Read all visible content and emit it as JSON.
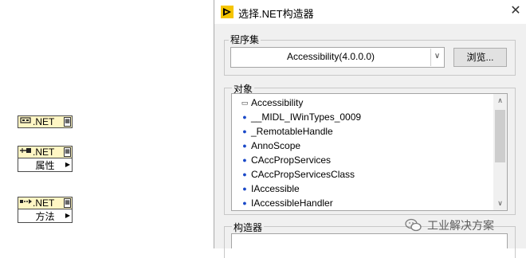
{
  "nodes": [
    {
      "icon_name": "constructor-node-icon",
      "label": ".NET",
      "rows": []
    },
    {
      "icon_name": "property-node-icon",
      "label": ".NET",
      "rows": [
        "属性"
      ]
    },
    {
      "icon_name": "invoke-node-icon",
      "label": ".NET",
      "rows": [
        "方法"
      ]
    }
  ],
  "dialog": {
    "title": "选择.NET构造器",
    "close_glyph": "✕",
    "assembly_label": "程序集",
    "assembly_value": "Accessibility(4.0.0.0)",
    "browse_label": "浏览...",
    "objects_label": "对象",
    "objects": [
      {
        "text": "Accessibility",
        "bullet": "▭"
      },
      {
        "text": "__MIDL_IWinTypes_0009",
        "bullet": "●"
      },
      {
        "text": "_RemotableHandle",
        "bullet": "●"
      },
      {
        "text": "AnnoScope",
        "bullet": "●"
      },
      {
        "text": "CAccPropServices",
        "bullet": "●"
      },
      {
        "text": "CAccPropServicesClass",
        "bullet": "●"
      },
      {
        "text": "IAccessible",
        "bullet": "●"
      },
      {
        "text": "IAccessibleHandler",
        "bullet": "●"
      }
    ],
    "constructors_label": "构造器"
  },
  "watermark": {
    "text": "工业解决方案",
    "icon_name": "wechat-icon"
  },
  "colors": {
    "node_header": "#fff6c4",
    "bullet": "#1a49c8",
    "dialog_bg": "#f0f0f0"
  }
}
